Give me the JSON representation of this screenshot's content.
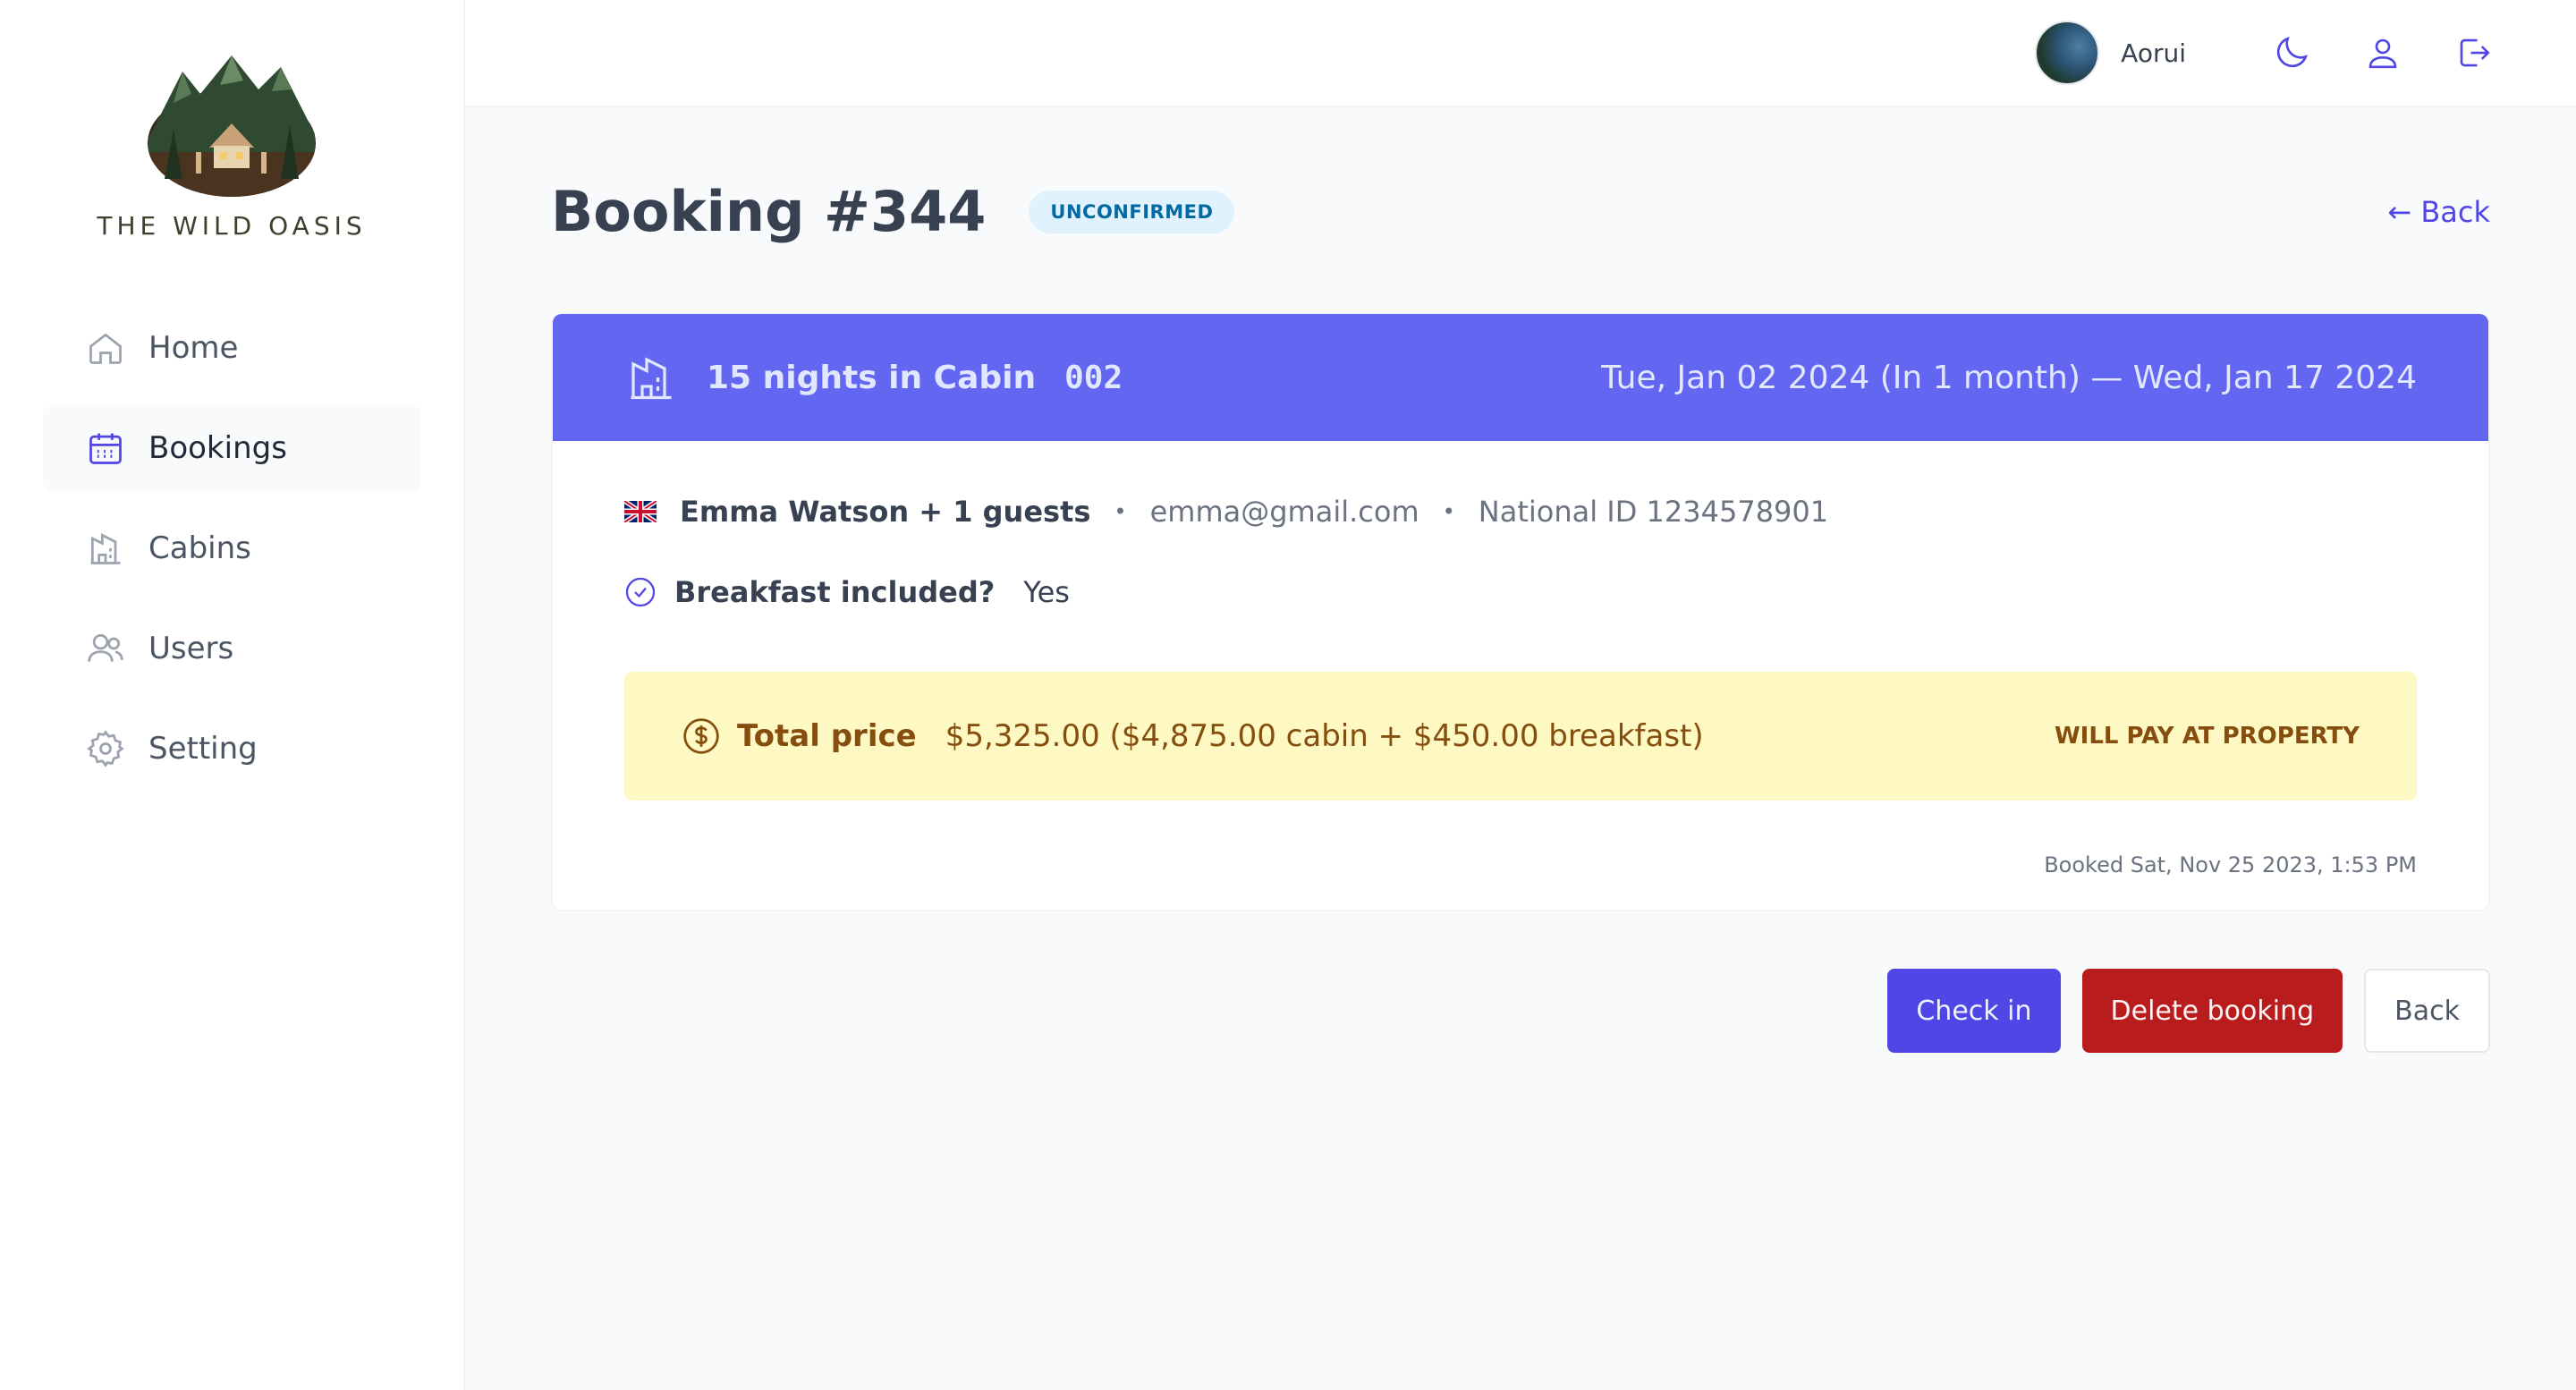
{
  "app": {
    "name": "THE WILD OASIS"
  },
  "sidebar": {
    "items": [
      {
        "label": "Home",
        "icon": "home-icon"
      },
      {
        "label": "Bookings",
        "icon": "calendar-icon",
        "active": true
      },
      {
        "label": "Cabins",
        "icon": "cabin-icon"
      },
      {
        "label": "Users",
        "icon": "users-icon"
      },
      {
        "label": "Setting",
        "icon": "gear-icon"
      }
    ]
  },
  "header": {
    "username": "Aorui",
    "icons": [
      "moon-icon",
      "user-icon",
      "logout-icon"
    ]
  },
  "page": {
    "title": "Booking #344",
    "status": "UNCONFIRMED",
    "back_link": "← Back"
  },
  "booking": {
    "nights_text": "15 nights in Cabin",
    "cabin_code": "002",
    "dates": "Tue, Jan 02 2024 (In 1 month) — Wed, Jan 17 2024",
    "guest": "Emma Watson + 1 guests",
    "email": "emma@gmail.com",
    "national_id": "National ID 1234578901",
    "breakfast_label": "Breakfast included?",
    "breakfast_value": "Yes",
    "price_label": "Total price",
    "price_value": "$5,325.00 ($4,875.00 cabin + $450.00 breakfast)",
    "payment_status": "WILL PAY AT PROPERTY",
    "booked_at": "Booked Sat, Nov 25 2023, 1:53 PM",
    "separator": "•"
  },
  "actions": {
    "check_in": "Check in",
    "delete": "Delete booking",
    "back": "Back"
  },
  "colors": {
    "accent": "#4f46e5",
    "header_band": "#6366f1",
    "danger": "#b91c1c",
    "price_bg": "#fef9c3",
    "price_text": "#854d0e"
  }
}
